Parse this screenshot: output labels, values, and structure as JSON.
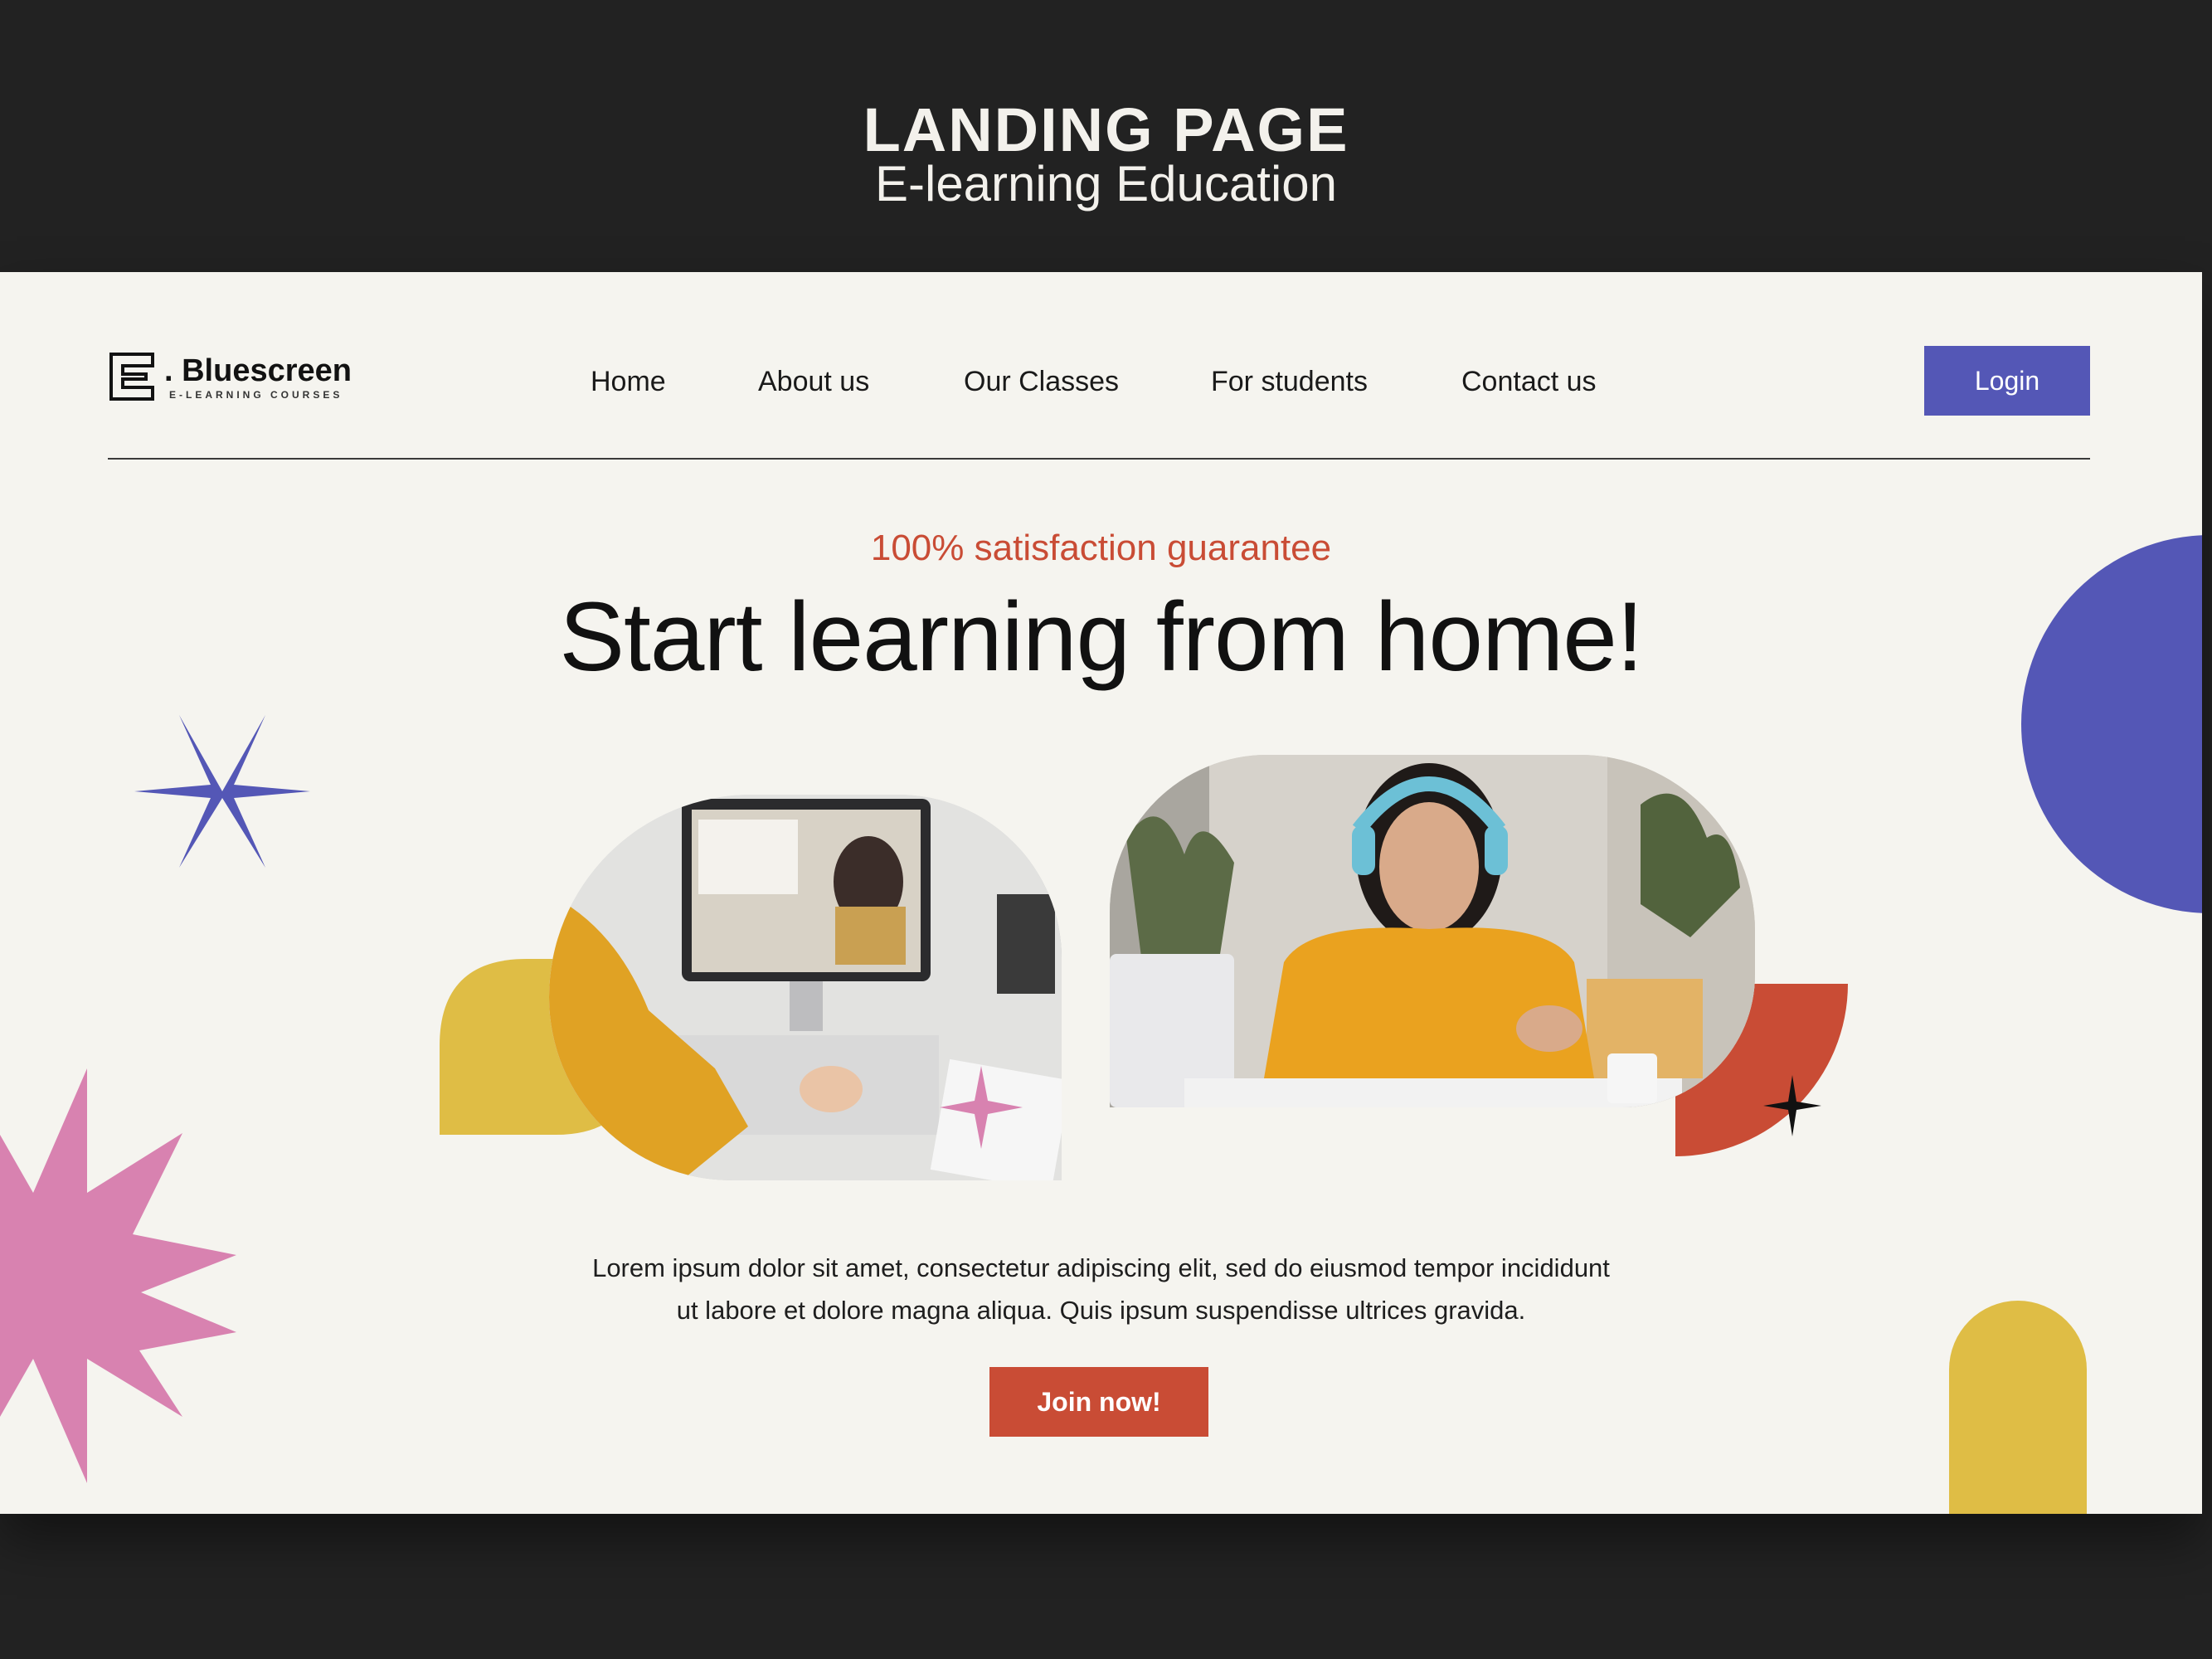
{
  "banner": {
    "title": "LANDING PAGE",
    "subtitle": "E-learning Education"
  },
  "logo": {
    "name": ". Bluescreen",
    "tagline": "E-LEARNING COURSES"
  },
  "nav": {
    "items": [
      {
        "label": "Home"
      },
      {
        "label": "About us"
      },
      {
        "label": "Our Classes"
      },
      {
        "label": "For students"
      },
      {
        "label": "Contact us"
      }
    ],
    "login_label": "Login"
  },
  "hero": {
    "tagline": "100% satisfaction guarantee",
    "headline": "Start learning from home!",
    "body_line1": "Lorem ipsum dolor sit amet, consectetur adipiscing elit, sed do eiusmod tempor incididunt",
    "body_line2": "ut labore et dolore magna aliqua. Quis ipsum suspendisse ultrices gravida.",
    "cta_label": "Join now!"
  },
  "colors": {
    "brand_blue": "#5457b6",
    "accent_red": "#c94c35",
    "accent_yellow": "#dfbd45",
    "accent_pink": "#d882b0",
    "page_bg": "#f5f4ef",
    "frame_bg": "#222222"
  },
  "images": {
    "photo1": "girl-in-orange-sweater-attending-video-lesson-on-computer",
    "photo2": "woman-with-headphones-writing-in-notebook"
  }
}
